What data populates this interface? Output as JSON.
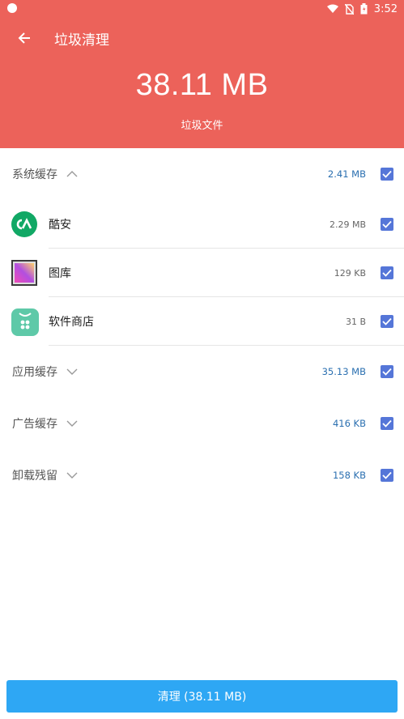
{
  "status": {
    "time": "3:52"
  },
  "header": {
    "title": "垃圾清理",
    "total": "38.11 MB",
    "subtitle": "垃圾文件"
  },
  "groups": [
    {
      "label": "系统缓存",
      "size": "2.41 MB",
      "expanded": true,
      "items": [
        {
          "name": "酷安",
          "size": "2.29 MB",
          "icon": "coolapk-icon"
        },
        {
          "name": "图库",
          "size": "129 KB",
          "icon": "gallery-icon"
        },
        {
          "name": "软件商店",
          "size": "31 B",
          "icon": "app-store-icon"
        }
      ]
    },
    {
      "label": "应用缓存",
      "size": "35.13 MB",
      "expanded": false
    },
    {
      "label": "广告缓存",
      "size": "416 KB",
      "expanded": false
    },
    {
      "label": "卸载残留",
      "size": "158 KB",
      "expanded": false
    }
  ],
  "button": {
    "label": "清理 (38.11 MB)"
  },
  "colors": {
    "header": "#ec625a",
    "checkbox": "#5576d8",
    "button": "#2ea7f4",
    "size_text": "#2a6fb0"
  }
}
